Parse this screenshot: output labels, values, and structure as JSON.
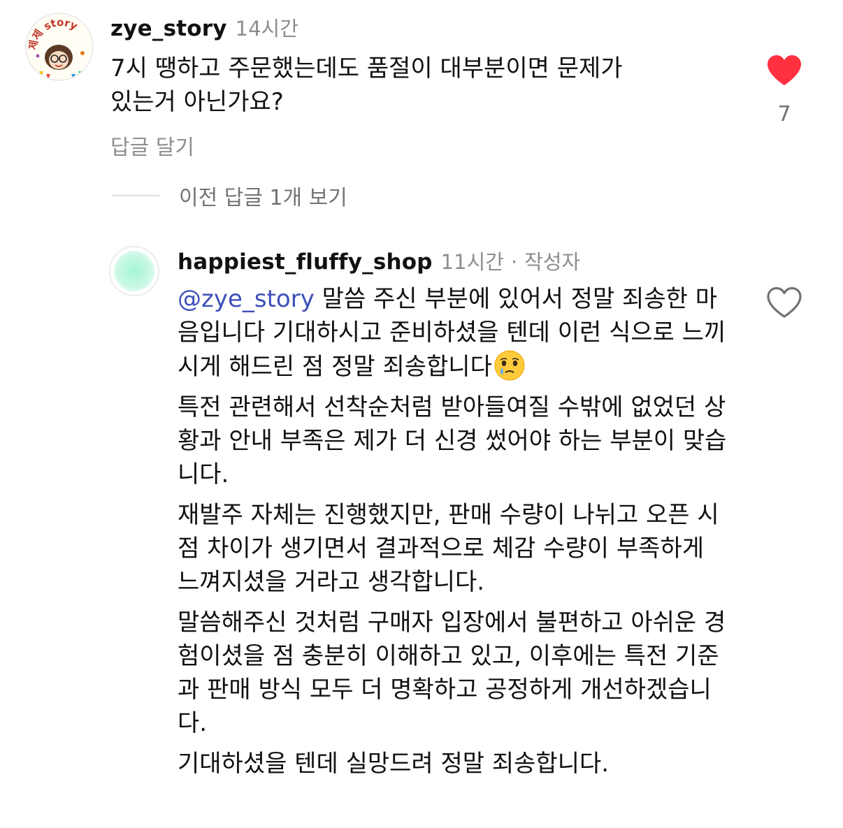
{
  "comment": {
    "avatar_text": "제제 story",
    "username": "zye_story",
    "time": "14시간",
    "text_line1": "7시 땡하고 주문했는데도 품절이 대부분이면 문제가",
    "text_line2": "있는거 아닌가요?",
    "reply_label": "답글 달기",
    "like_count": "7",
    "liked": true,
    "like_color": "#ff3040"
  },
  "view_replies_label": "이전 답글 1개 보기",
  "reply": {
    "username": "happiest_fluffy_shop",
    "time": "11시간",
    "separator": "·",
    "badge": "작성자",
    "mention": "@zye_story",
    "p1_rest": " 말씀 주신 부분에 있어서 정말 죄송한 마음입니다  기대하시고 준비하셨을 텐데 이런 식으로 느끼시게 해드린 점 정말 죄송합니다",
    "emoji": "face-holding-back-tears",
    "paragraphs": [
      "특전 관련해서 선착순처럼 받아들여질 수밖에 없었던 상황과 안내 부족은 제가 더 신경 썼어야 하는 부분이 맞습니다.",
      "재발주 자체는 진행했지만, 판매 수량이 나뉘고 오픈 시점 차이가 생기면서 결과적으로 체감 수량이 부족하게 느껴지셨을 거라고 생각합니다.",
      "말씀해주신 것처럼 구매자 입장에서 불편하고 아쉬운 경험이셨을 점 충분히 이해하고 있고, 이후에는 특전 기준과 판매 방식 모두 더 명확하고 공정하게 개선하겠습니다.",
      "기대하셨을 텐데 실망드려 정말 죄송합니다."
    ],
    "liked": false
  }
}
